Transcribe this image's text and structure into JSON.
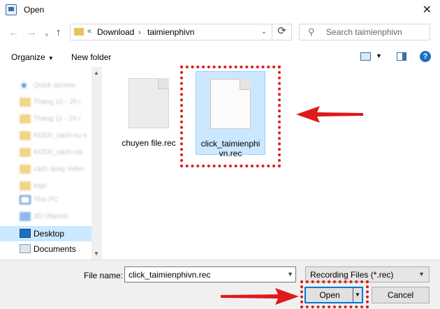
{
  "window": {
    "title": "Open"
  },
  "nav": {
    "breadcrumb_prefix": "«",
    "crumbs": [
      "Download",
      "taimienphivn"
    ],
    "search_placeholder": "Search taimienphivn"
  },
  "toolbar": {
    "organize_label": "Organize",
    "new_folder_label": "New folder"
  },
  "sidebar": {
    "items": [
      {
        "label": "Quick access",
        "icon": "star-icon",
        "blurred": true
      },
      {
        "label": "Thang 10 - 20 r",
        "icon": "folder-icon",
        "blurred": true
      },
      {
        "label": "Thang 11 - 20 r",
        "icon": "folder-icon",
        "blurred": true
      },
      {
        "label": "KOD0_cach-xu-s",
        "icon": "folder-icon",
        "blurred": true
      },
      {
        "label": "KOD0_cach-cai",
        "icon": "folder-icon",
        "blurred": true
      },
      {
        "label": "cach quay video",
        "icon": "folder-icon",
        "blurred": true
      },
      {
        "label": "logo",
        "icon": "folder-icon",
        "blurred": true
      },
      {
        "label": "This PC",
        "icon": "pc-icon",
        "blurred": true
      },
      {
        "label": "3D Objects",
        "icon": "cube-icon",
        "blurred": true
      },
      {
        "label": "Desktop",
        "icon": "desktop-icon",
        "selected": true
      },
      {
        "label": "Documents",
        "icon": "documents-icon"
      }
    ]
  },
  "files": [
    {
      "name": "chuyen file.rec",
      "icon": "file-icon"
    },
    {
      "name": "click_taimienphivn.rec",
      "icon": "file-icon",
      "selected": true
    }
  ],
  "bottom": {
    "file_name_label": "File name:",
    "file_name_value": "click_taimienphivn.rec",
    "filter_value": "Recording Files (*.rec)",
    "open_label": "Open",
    "cancel_label": "Cancel"
  },
  "colors": {
    "selection": "#cce8ff",
    "annotation_red": "#e01919",
    "accent_blue": "#0078d7"
  }
}
